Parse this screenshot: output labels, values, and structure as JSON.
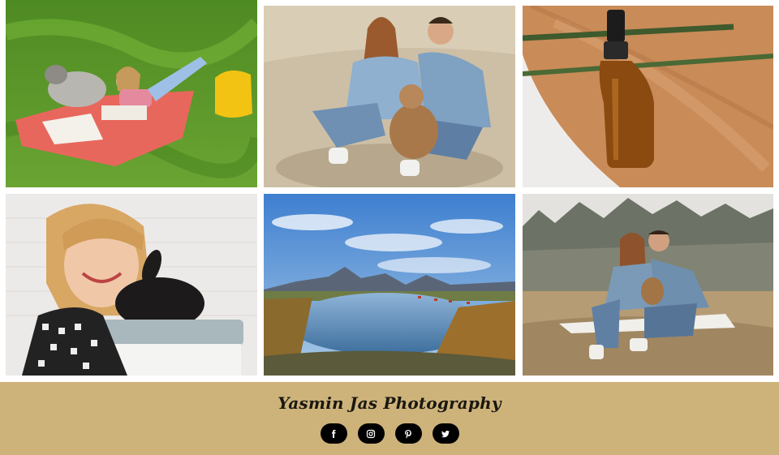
{
  "gallery": {
    "photos": [
      {
        "subject": "girl reading with husky on blanket in grass"
      },
      {
        "subject": "couple sitting with dog on dry grass"
      },
      {
        "subject": "amber dropper bottle on wood slice"
      },
      {
        "subject": "smiling girl hugging black rabbit"
      },
      {
        "subject": "mountain lake landscape with village"
      },
      {
        "subject": "couple kissing with dog in field"
      }
    ]
  },
  "footer": {
    "brand": "Yasmin Jas Photography",
    "background": "#cdb37a",
    "socials": [
      {
        "icon": "facebook-icon"
      },
      {
        "icon": "instagram-icon"
      },
      {
        "icon": "pinterest-icon"
      },
      {
        "icon": "twitter-icon"
      }
    ]
  }
}
